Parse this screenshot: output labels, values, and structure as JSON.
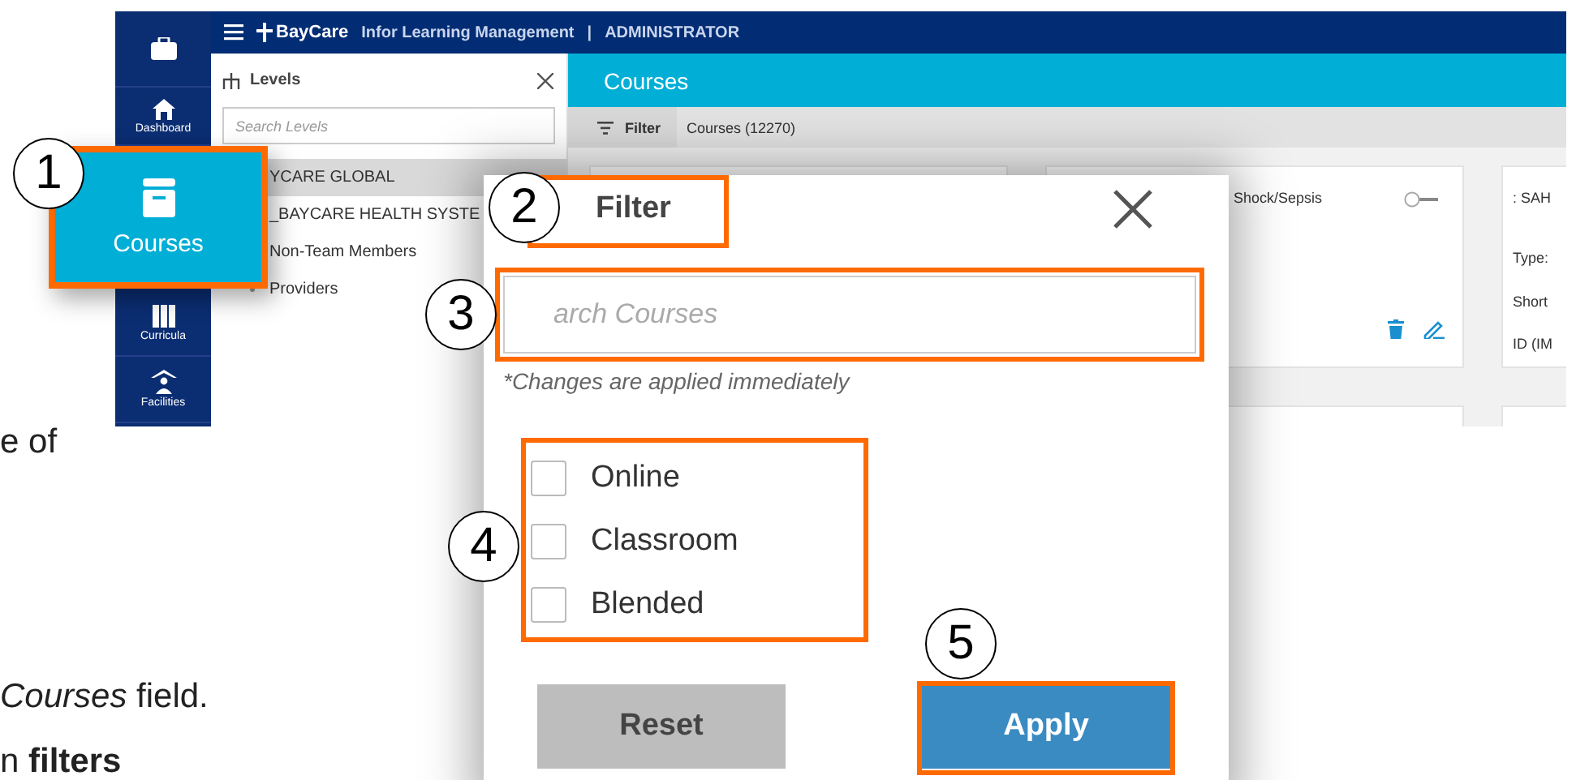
{
  "doc_text": [
    {
      "text": "e of"
    },
    {
      "text": "*Courses* field."
    },
    {
      "text": "n **filters**"
    }
  ],
  "app": {
    "nav": [
      {
        "kind": "briefcase"
      },
      {
        "kind": "home",
        "label": "Dashboard"
      },
      {
        "kind": "curricula",
        "label": "Curricula"
      },
      {
        "kind": "facilities",
        "label": "Facilities"
      }
    ],
    "header": {
      "brand": "BayCare",
      "title": "Infor Learning Management",
      "separator": "|",
      "role": "ADMINISTRATOR"
    },
    "levels_panel": {
      "title": "Levels",
      "search": {
        "placeholder": "Search Levels"
      },
      "items": [
        {
          "label": "YCARE GLOBAL",
          "selected": true,
          "kind": "plain"
        },
        {
          "label": "_BAYCARE HEALTH SYSTE",
          "selected": false,
          "kind": "plain"
        },
        {
          "label": "Non-Team Members",
          "selected": false,
          "kind": "plain"
        },
        {
          "label": "Providers",
          "selected": false,
          "kind": "bullet"
        }
      ]
    },
    "page_title": "Courses",
    "toolbar": {
      "filter": "Filter",
      "count": "Courses (12270)"
    },
    "cards": [
      {
        "kind": "hidden"
      },
      {
        "kind": "course",
        "title": "Shock/Sepsis",
        "on": false
      },
      {
        "kind": "partial",
        "title": ": SAH",
        "lines": [
          "Type:",
          "Short",
          "ID (IM"
        ]
      }
    ]
  },
  "filter_dialog": {
    "title": "Filter",
    "search": {
      "placeholder": "arch Courses"
    },
    "note": "*Changes are applied immediately",
    "options": [
      {
        "label": "Online",
        "checked": false
      },
      {
        "label": "Classroom",
        "checked": false
      },
      {
        "label": "Blended",
        "checked": false
      }
    ],
    "buttons": [
      {
        "label": "Reset",
        "kind": "secondary"
      },
      {
        "label": "Apply",
        "kind": "primary"
      }
    ]
  },
  "callout_tile": {
    "label": "Courses"
  },
  "callouts": [
    "1",
    "2",
    "3",
    "4",
    "5"
  ]
}
